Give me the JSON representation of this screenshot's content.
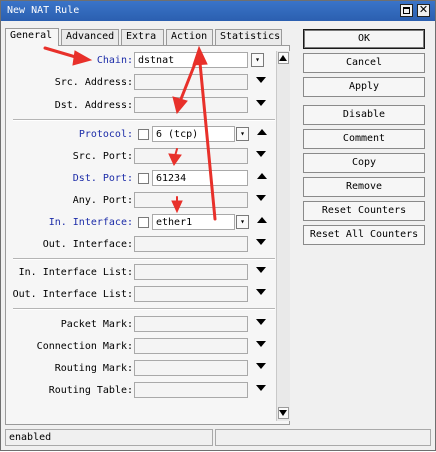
{
  "window": {
    "title": "New NAT Rule"
  },
  "tabs": [
    {
      "label": "General",
      "active": true
    },
    {
      "label": "Advanced",
      "active": false
    },
    {
      "label": "Extra",
      "active": false
    },
    {
      "label": "Action",
      "active": false
    },
    {
      "label": "Statistics",
      "active": false
    }
  ],
  "form": {
    "chain": {
      "label": "Chain:",
      "value": "dstnat"
    },
    "src_address": {
      "label": "Src. Address:",
      "value": ""
    },
    "dst_address": {
      "label": "Dst. Address:",
      "value": ""
    },
    "protocol": {
      "label": "Protocol:",
      "value": "6 (tcp)"
    },
    "src_port": {
      "label": "Src. Port:",
      "value": ""
    },
    "dst_port": {
      "label": "Dst. Port:",
      "value": "61234"
    },
    "any_port": {
      "label": "Any. Port:",
      "value": ""
    },
    "in_interface": {
      "label": "In. Interface:",
      "value": "ether1"
    },
    "out_interface": {
      "label": "Out. Interface:",
      "value": ""
    },
    "in_interface_list": {
      "label": "In. Interface List:",
      "value": ""
    },
    "out_interface_list": {
      "label": "Out. Interface List:",
      "value": ""
    },
    "packet_mark": {
      "label": "Packet Mark:",
      "value": ""
    },
    "connection_mark": {
      "label": "Connection Mark:",
      "value": ""
    },
    "routing_mark": {
      "label": "Routing Mark:",
      "value": ""
    },
    "routing_table": {
      "label": "Routing Table:",
      "value": ""
    }
  },
  "buttons": {
    "ok": "OK",
    "cancel": "Cancel",
    "apply": "Apply",
    "disable": "Disable",
    "comment": "Comment",
    "copy": "Copy",
    "remove": "Remove",
    "reset_counters": "Reset Counters",
    "reset_all_counters": "Reset All Counters"
  },
  "status": {
    "text": "enabled"
  },
  "colors": {
    "titlebar": "#2f66bc",
    "label_highlight": "#1c2ca8",
    "annotation": "#e8302a"
  },
  "icons": {
    "close": "close-icon",
    "restore": "restore-icon"
  }
}
